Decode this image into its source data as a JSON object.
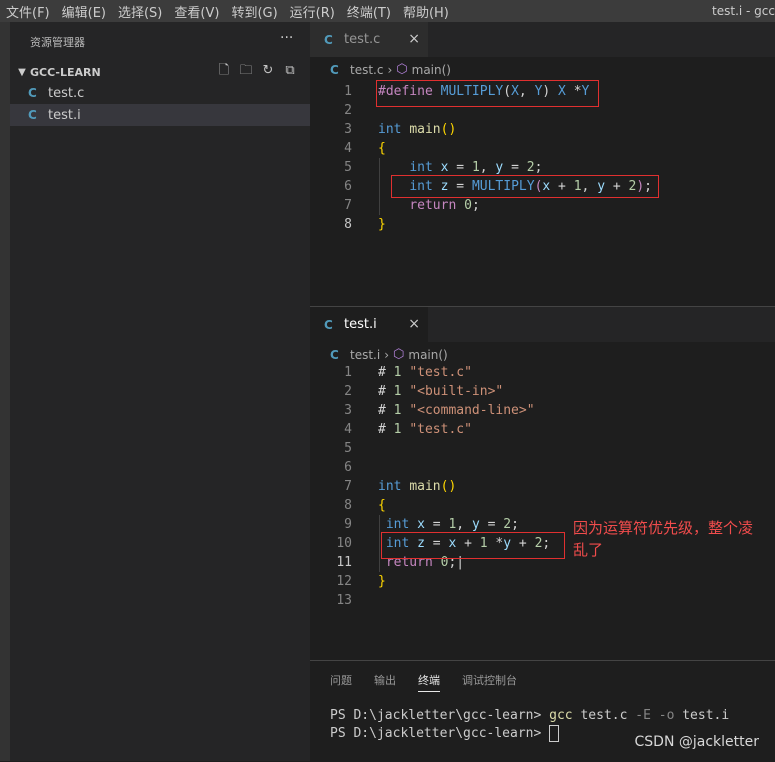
{
  "menubar": {
    "items": [
      "文件(F)",
      "编辑(E)",
      "选择(S)",
      "查看(V)",
      "转到(G)",
      "运行(R)",
      "终端(T)",
      "帮助(H)"
    ],
    "window_title": "test.i - gcc"
  },
  "explorer": {
    "header": "资源管理器",
    "more_icon": "···",
    "folder_name": "GCC-LEARN",
    "files": [
      {
        "name": "test.c",
        "icon": "C",
        "selected": false
      },
      {
        "name": "test.i",
        "icon": "C",
        "selected": true
      }
    ]
  },
  "editor_top": {
    "tab_label": "test.c",
    "tab_close": "×",
    "breadcrumb_file": "test.c",
    "breadcrumb_symbol": "main()",
    "line_numbers": [
      "1",
      "2",
      "3",
      "4",
      "5",
      "6",
      "7",
      "8"
    ],
    "current_line": "8"
  },
  "editor_bottom": {
    "tab_label": "test.i",
    "tab_close": "×",
    "breadcrumb_file": "test.i",
    "breadcrumb_symbol": "main()",
    "line_numbers": [
      "1",
      "2",
      "3",
      "4",
      "5",
      "6",
      "7",
      "8",
      "9",
      "10",
      "11",
      "12",
      "13"
    ],
    "current_line": "11",
    "annotation_line1": "因为运算符优先级，整个凌",
    "annotation_line2": "乱了"
  },
  "panel": {
    "tabs": [
      "问题",
      "输出",
      "终端",
      "调试控制台"
    ],
    "active_tab": "终端",
    "prompt": "PS D:\\jackletter\\gcc-learn> ",
    "cmd_name": "gcc",
    "cmd_file": " test.c ",
    "cmd_flag1": "-E",
    "cmd_flag2": "-o",
    "cmd_out": " test.i",
    "prompt2": "PS D:\\jackletter\\gcc-learn> "
  },
  "watermark": "CSDN @jackletter",
  "colors": {
    "accent_red": "#e03030",
    "c_icon": "#519aba"
  }
}
